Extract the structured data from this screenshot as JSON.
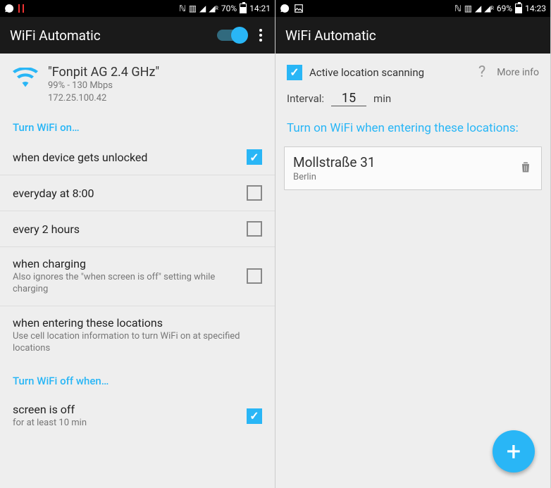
{
  "left": {
    "status": {
      "battery": "70%",
      "time": "14:21"
    },
    "appbar": {
      "title": "WiFi Automatic"
    },
    "wifi": {
      "ssid": "\"Fonpit AG 2.4 GHz\"",
      "sub1": "99% - 130 Mbps",
      "sub2": "172.25.100.42"
    },
    "sectionOn": "Turn WiFi on…",
    "rows": [
      {
        "label": "when device gets unlocked",
        "desc": "",
        "checked": true
      },
      {
        "label": "everyday at 8:00",
        "desc": "",
        "checked": false
      },
      {
        "label": "every 2 hours",
        "desc": "",
        "checked": false
      },
      {
        "label": "when charging",
        "desc": "Also ignores the \"when screen is off\" setting while charging",
        "checked": false
      },
      {
        "label": "when entering these locations",
        "desc": "Use cell location information to turn WiFi on at specified locations",
        "checked": null
      }
    ],
    "sectionOff": "Turn WiFi off when…",
    "rowsOff": [
      {
        "label": "screen is off",
        "desc": "for at least 10 min",
        "checked": true
      }
    ]
  },
  "right": {
    "status": {
      "battery": "69%",
      "time": "14:23"
    },
    "appbar": {
      "title": "WiFi Automatic"
    },
    "activeScan": "Active location scanning",
    "moreInfo": "More info",
    "intervalLabel": "Interval:",
    "intervalVal": "15",
    "intervalUnit": "min",
    "locSection": "Turn on WiFi when entering these locations:",
    "location": {
      "name": "Mollstraße 31",
      "city": "Berlin"
    }
  }
}
